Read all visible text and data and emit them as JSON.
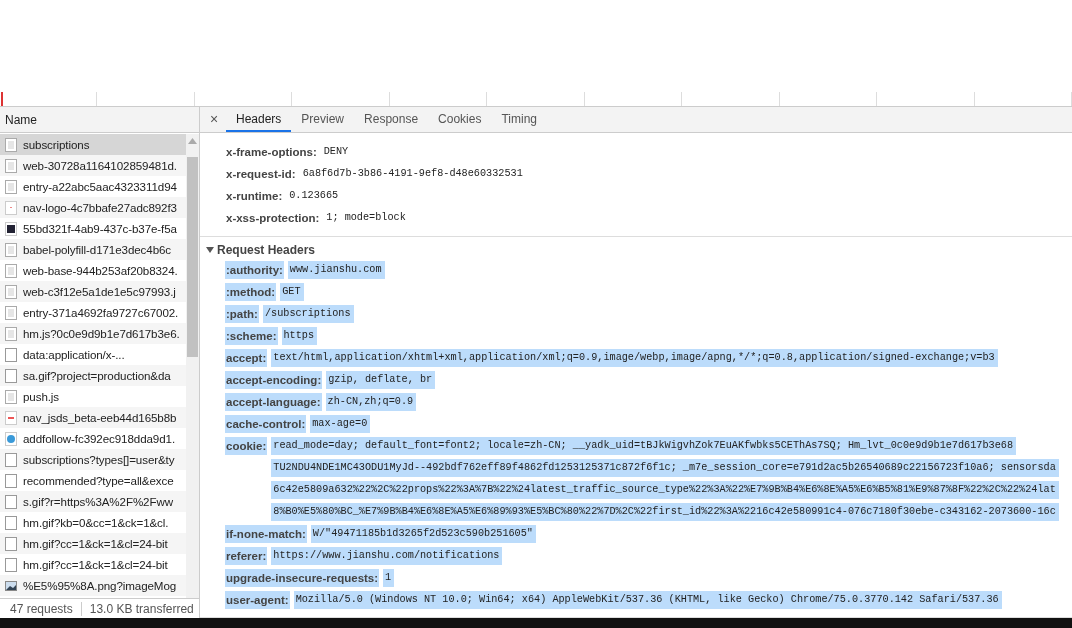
{
  "timeline": {
    "marker": true
  },
  "requests_panel": {
    "column_header": "Name",
    "items": [
      {
        "name": "subscriptions",
        "kind": "document",
        "selected": true
      },
      {
        "name": "web-30728a1164102859481d.",
        "kind": "document",
        "selected": false
      },
      {
        "name": "entry-a22abc5aac4323311d94",
        "kind": "document",
        "selected": false
      },
      {
        "name": "nav-logo-4c7bbafe27adc892f3",
        "kind": "image",
        "selected": false
      },
      {
        "name": "55bd321f-4ab9-437c-b37e-f5a",
        "kind": "dark-image",
        "selected": false
      },
      {
        "name": "babel-polyfill-d171e3dec4b6c",
        "kind": "document",
        "selected": false
      },
      {
        "name": "web-base-944b253af20b8324.",
        "kind": "document",
        "selected": false
      },
      {
        "name": "web-c3f12e5a1de1e5c97993.j",
        "kind": "document",
        "selected": false
      },
      {
        "name": "entry-371a4692fa9727c67002.",
        "kind": "document",
        "selected": false
      },
      {
        "name": "hm.js?0c0e9d9b1e7d617b3e6.",
        "kind": "document",
        "selected": false
      },
      {
        "name": "data:application/x-...",
        "kind": "blank",
        "selected": false
      },
      {
        "name": "sa.gif?project=production&da",
        "kind": "blank",
        "selected": false
      },
      {
        "name": "push.js",
        "kind": "document",
        "selected": false
      },
      {
        "name": "nav_jsds_beta-eeb44d165b8b",
        "kind": "dash",
        "selected": false
      },
      {
        "name": "addfollow-fc392ec918dda9d1.",
        "kind": "follow",
        "selected": false
      },
      {
        "name": "subscriptions?types[]=user&ty",
        "kind": "blank",
        "selected": false
      },
      {
        "name": "recommended?type=all&exce",
        "kind": "blank",
        "selected": false
      },
      {
        "name": "s.gif?r=https%3A%2F%2Fww",
        "kind": "blank",
        "selected": false
      },
      {
        "name": "hm.gif?kb=0&cc=1&ck=1&cl.",
        "kind": "blank",
        "selected": false
      },
      {
        "name": "hm.gif?cc=1&ck=1&cl=24-bit",
        "kind": "blank",
        "selected": false
      },
      {
        "name": "hm.gif?cc=1&ck=1&cl=24-bit",
        "kind": "blank",
        "selected": false
      },
      {
        "name": "%E5%95%8A.png?imageMog",
        "kind": "photo",
        "selected": false
      }
    ],
    "status_bar": {
      "requests": "47 requests",
      "transferred": "13.0 KB transferred"
    }
  },
  "details": {
    "close": "×",
    "tabs": [
      {
        "label": "Headers",
        "selected": true
      },
      {
        "label": "Preview",
        "selected": false
      },
      {
        "label": "Response",
        "selected": false
      },
      {
        "label": "Cookies",
        "selected": false
      },
      {
        "label": "Timing",
        "selected": false
      }
    ],
    "response_headers": [
      {
        "name": "x-frame-options:",
        "value": [
          "DENY"
        ],
        "highlighted": false
      },
      {
        "name": "x-request-id:",
        "value": [
          "6a8f6d7b-3b86-4191-9ef8-d48e60332531"
        ],
        "highlighted": false
      },
      {
        "name": "x-runtime:",
        "value": [
          "0.123665"
        ],
        "highlighted": false
      },
      {
        "name": "x-xss-protection:",
        "value": [
          "1; mode=block"
        ],
        "highlighted": false
      }
    ],
    "request_section": {
      "title": "Request Headers",
      "expanded": true
    },
    "request_headers": [
      {
        "name": ":authority:",
        "value": [
          "www.jianshu.com"
        ],
        "highlighted": true
      },
      {
        "name": ":method:",
        "value": [
          "GET"
        ],
        "highlighted": true
      },
      {
        "name": ":path:",
        "value": [
          "/subscriptions"
        ],
        "highlighted": true
      },
      {
        "name": ":scheme:",
        "value": [
          "https"
        ],
        "highlighted": true
      },
      {
        "name": "accept:",
        "value": [
          "text/html,application/xhtml+xml,application/xml;q=0.9,image/webp,image/apng,*/*;q=0.8,application/signed-exchange;v=b3"
        ],
        "highlighted": true
      },
      {
        "name": "accept-encoding:",
        "value": [
          "gzip, deflate, br"
        ],
        "highlighted": true
      },
      {
        "name": "accept-language:",
        "value": [
          "zh-CN,zh;q=0.9"
        ],
        "highlighted": true
      },
      {
        "name": "cache-control:",
        "value": [
          "max-age=0"
        ],
        "highlighted": true
      },
      {
        "name": "cookie:",
        "value": [
          "read_mode=day; default_font=font2; locale=zh-CN; __yadk_uid=tBJkWigvhZok7EuAKfwbks5CEThAs7SQ; Hm_lvt_0c0e9d9b1e7d617b3e68",
          "TU2NDU4NDE1MC43ODU1MyJd--492bdf762eff89f4862fd1253125371c872f6f1c; _m7e_session_core=e791d2ac5b26540689c22156723f10a6; sensorsda",
          "6c42e5809a632%22%2C%22props%22%3A%7B%22%24latest_traffic_source_type%22%3A%22%E7%9B%B4%E6%8E%A5%E6%B5%81%E9%87%8F%22%2C%22%24lat",
          "8%B0%E5%80%BC_%E7%9B%B4%E6%8E%A5%E6%89%93%E5%BC%80%22%7D%2C%22first_id%22%3A%2216c42e580991c4-076c7180f30ebe-c343162-2073600-16c"
        ],
        "highlighted": true
      },
      {
        "name": "if-none-match:",
        "value": [
          "W/\"49471185b1d3265f2d523c590b251605\""
        ],
        "highlighted": true
      },
      {
        "name": "referer:",
        "value": [
          "https://www.jianshu.com/notifications"
        ],
        "highlighted": true
      },
      {
        "name": "upgrade-insecure-requests:",
        "value": [
          "1"
        ],
        "highlighted": true
      },
      {
        "name": "user-agent:",
        "value": [
          "Mozilla/5.0 (Windows NT 10.0; Win64; x64) AppleWebKit/537.36 (KHTML, like Gecko) Chrome/75.0.3770.142 Safari/537.36"
        ],
        "highlighted": true
      }
    ]
  }
}
